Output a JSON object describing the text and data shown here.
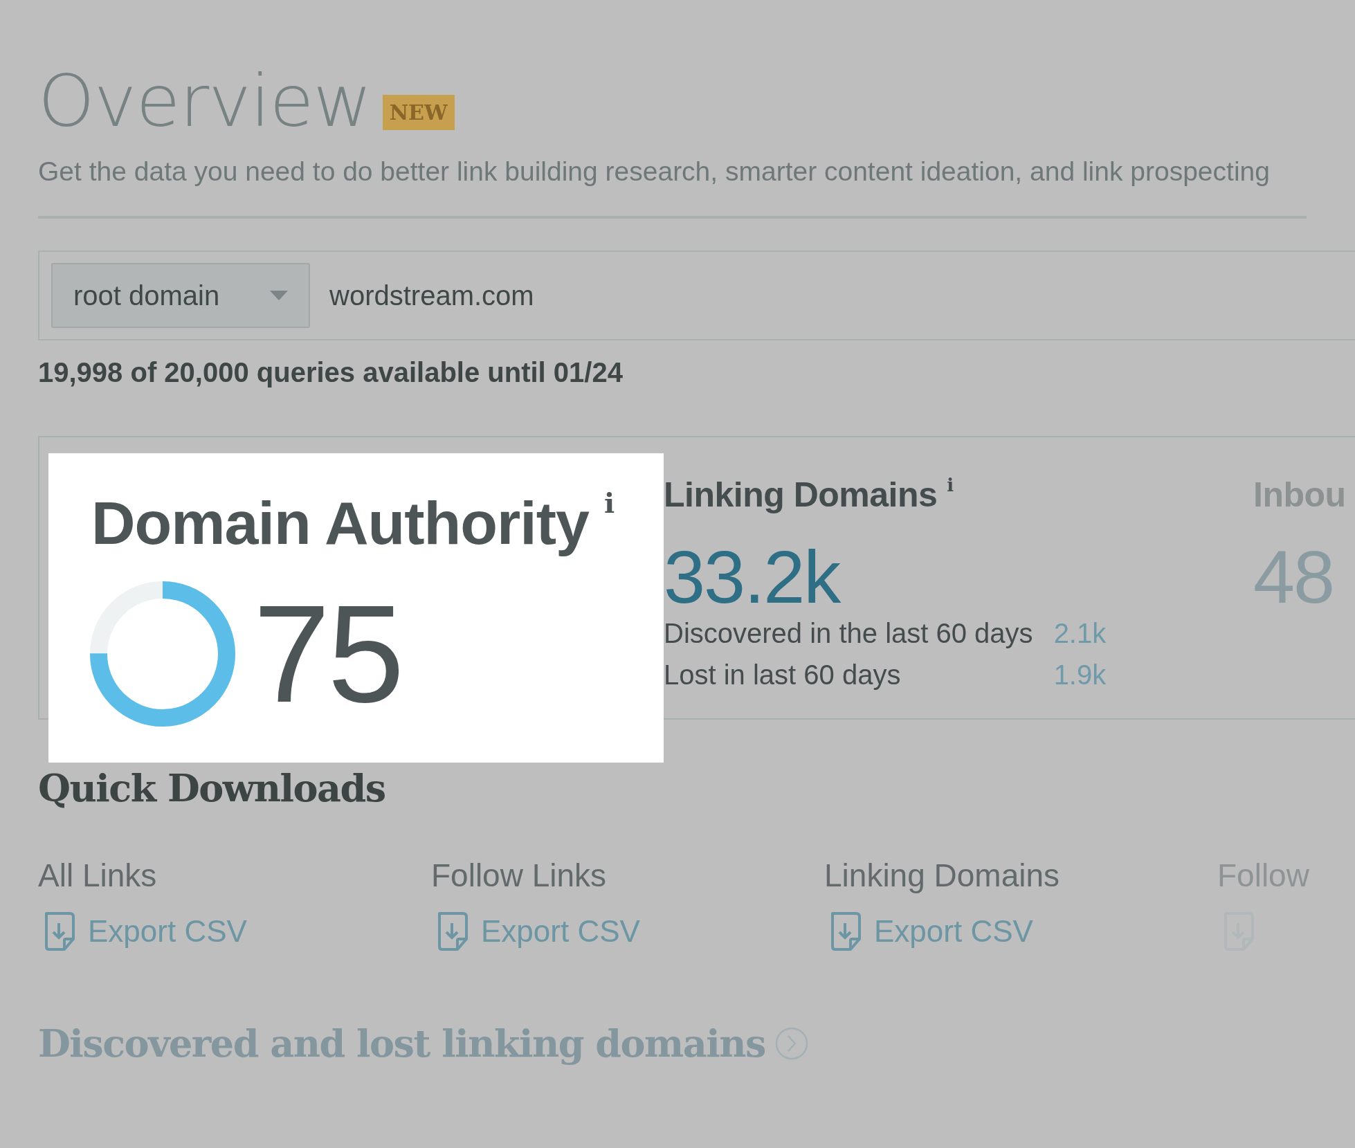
{
  "header": {
    "title": "Overview",
    "badge": "NEW",
    "subtitle": "Get the data you need to do better link building research, smarter content ideation, and link prospecting"
  },
  "search": {
    "scope": "root domain",
    "value": "wordstream.com"
  },
  "quota": "19,998 of 20,000 queries available until 01/24",
  "metrics": [
    {
      "kind": "donut",
      "label": "Domain Authority",
      "info": "i",
      "level": 0.75,
      "value": "75",
      "highlighted": true
    },
    {
      "kind": "stat",
      "label": "Linking Domains",
      "info": "i",
      "value": "33.2k",
      "rows": [
        {
          "label": "Discovered in the last 60 days",
          "value": "2.1k"
        },
        {
          "label": "Lost in last 60 days",
          "value": "1.9k"
        }
      ]
    },
    {
      "kind": "stat",
      "label": "Inbou",
      "value": "48"
    }
  ],
  "quick_downloads": {
    "title": "Quick Downloads",
    "items": [
      {
        "label": "All Links",
        "action": "Export CSV"
      },
      {
        "label": "Follow Links",
        "action": "Export CSV"
      },
      {
        "label": "Linking Domains",
        "action": "Export CSV"
      },
      {
        "label": "Follow"
      }
    ]
  },
  "section_link": "Discovered and lost linking domains"
}
